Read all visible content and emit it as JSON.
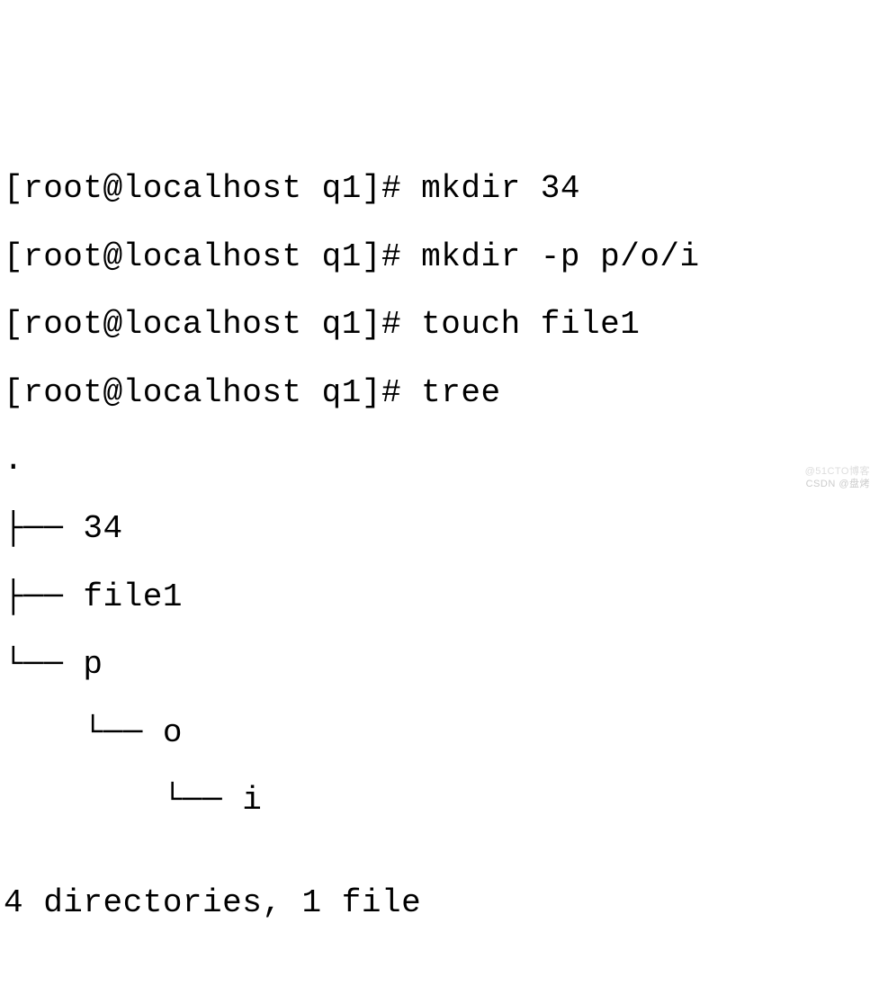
{
  "terminal": {
    "lines": [
      "[root@localhost q1]# mkdir 34",
      "[root@localhost q1]# mkdir -p p/o/i",
      "[root@localhost q1]# touch file1",
      "[root@localhost q1]# tree",
      ".",
      "├── 34",
      "├── file1",
      "└── p",
      "    └── o",
      "        └── i",
      "",
      "4 directories, 1 file"
    ]
  },
  "watermarks": {
    "top": "@51CTO博客",
    "bottom": "CSDN @盘烤"
  }
}
